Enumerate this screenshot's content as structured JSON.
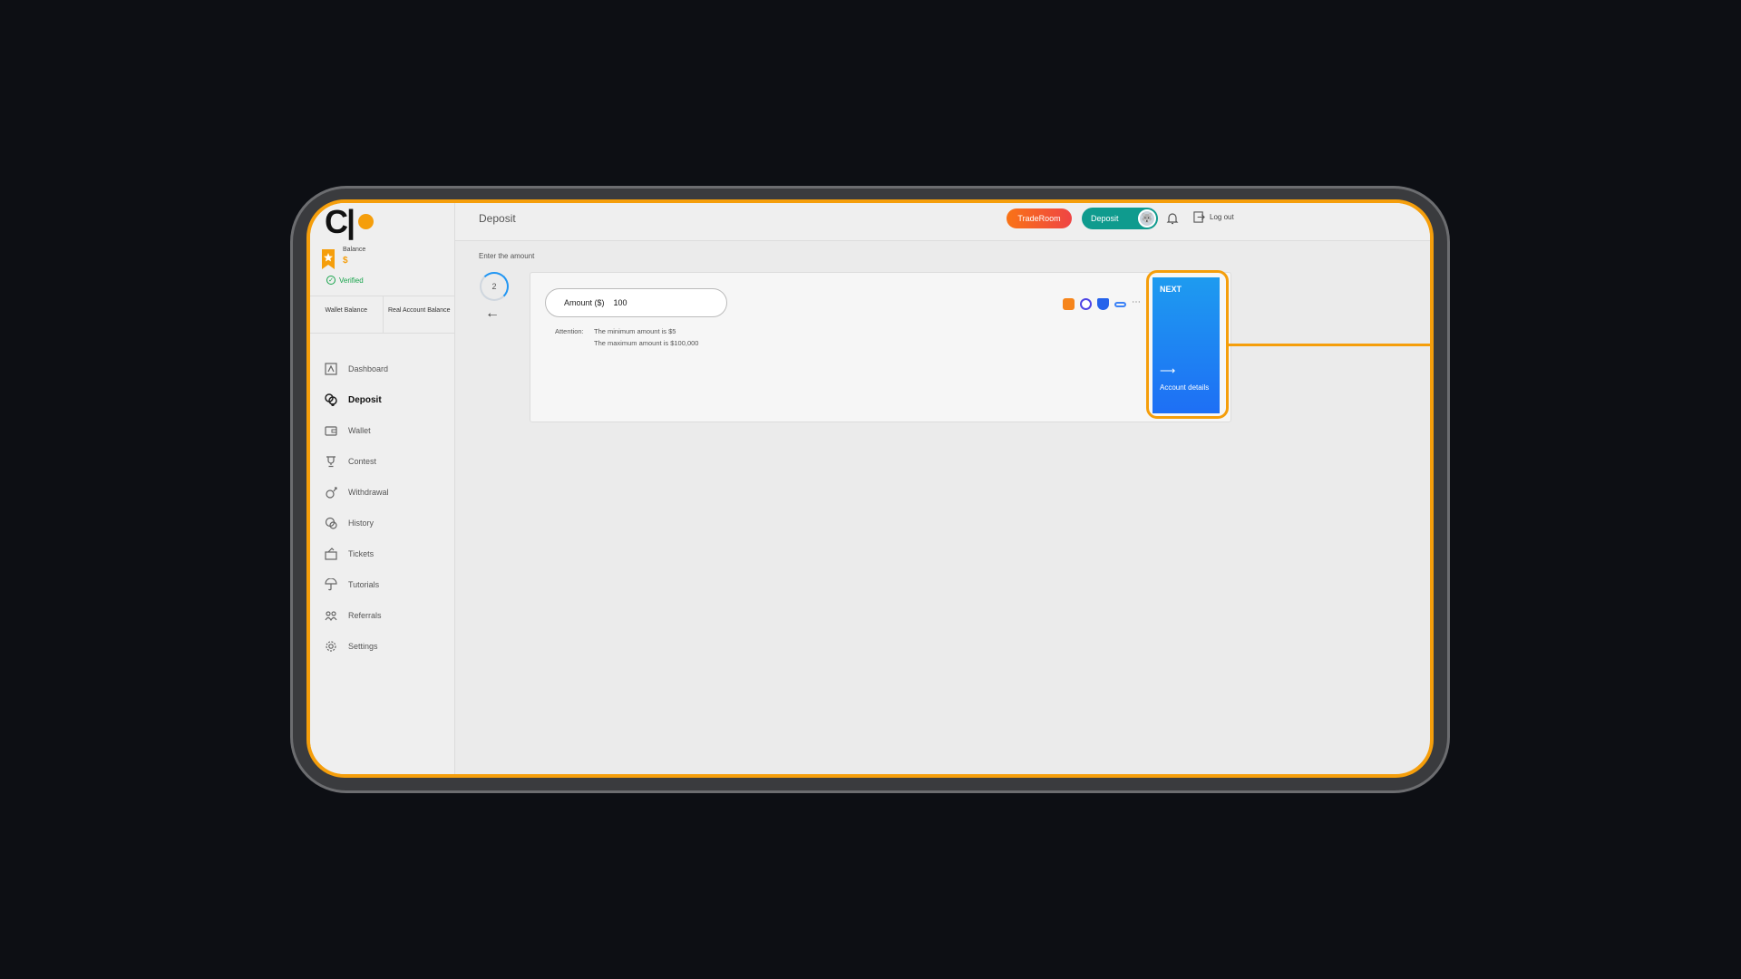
{
  "brand": {
    "logo_text": "C|",
    "accent_color": "#f59e0b"
  },
  "sidebar": {
    "balance_label": "Balance",
    "balance_value": "$",
    "verified_label": "Verified",
    "balance_tabs": [
      "Wallet Balance",
      "Real Account Balance"
    ],
    "items": [
      {
        "label": "Dashboard",
        "icon": "dashboard-icon"
      },
      {
        "label": "Deposit",
        "icon": "deposit-icon",
        "active": true
      },
      {
        "label": "Wallet",
        "icon": "wallet-icon"
      },
      {
        "label": "Contest",
        "icon": "trophy-icon"
      },
      {
        "label": "Withdrawal",
        "icon": "withdrawal-icon"
      },
      {
        "label": "History",
        "icon": "history-icon"
      },
      {
        "label": "Tickets",
        "icon": "ticket-icon"
      },
      {
        "label": "Tutorials",
        "icon": "tutorial-icon"
      },
      {
        "label": "Referrals",
        "icon": "referral-icon"
      },
      {
        "label": "Settings",
        "icon": "gear-icon"
      }
    ]
  },
  "header": {
    "title": "Deposit",
    "traderoom_label": "TradeRoom",
    "deposit_label": "Deposit",
    "logout_label": "Log out"
  },
  "main": {
    "section_label": "Enter the amount",
    "step_number": "2",
    "amount_label": "Amount ($)",
    "amount_value": "100",
    "attention_label": "Attention:",
    "attention_lines": [
      "The minimum amount is $5",
      "The maximum amount is $100,000"
    ],
    "payment_icons": [
      "metamask-icon",
      "coinbase-icon",
      "shield-wallet-icon",
      "link-icon"
    ],
    "next_label": "NEXT",
    "next_sub": "Account details"
  }
}
